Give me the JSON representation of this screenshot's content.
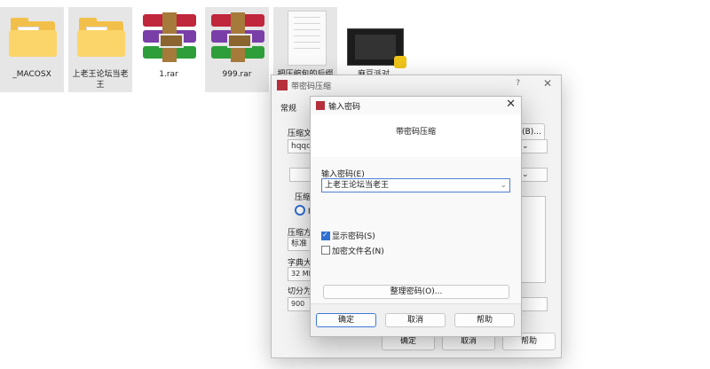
{
  "files": [
    {
      "name": "_MACOSX",
      "type": "folder",
      "selected": true
    },
    {
      "name": "上老王论坛当老王",
      "type": "folder",
      "selected": true
    },
    {
      "name": "1.rar",
      "type": "rar",
      "selected": false
    },
    {
      "name": "999.rar",
      "type": "rar",
      "selected": true
    },
    {
      "name": "把压缩包的后缀",
      "type": "document",
      "selected": true
    },
    {
      "name": "麻豆派对",
      "type": "video",
      "selected": false
    }
  ],
  "back_dialog": {
    "title": "带密码压缩",
    "help_icon": "?",
    "tab_general": "常规",
    "label_filename": "压缩文",
    "filename_value": "hqqq.r",
    "label_format": "压缩文",
    "format_option": "RA",
    "label_method": "压缩方",
    "method_value": "标准",
    "label_dict": "字典大",
    "dict_value": "32 MB",
    "label_split": "切分为",
    "split_value": "900",
    "browse_label": "(B)...",
    "ok_label": "确定",
    "cancel_label": "取消",
    "help_label": "帮助"
  },
  "password_dialog": {
    "title": "输入密码",
    "header": "带密码压缩",
    "password_label": "输入密码(E)",
    "password_value": "上老王论坛当老王",
    "show_password_label": "显示密码(S)",
    "show_password_checked": true,
    "encrypt_filenames_label": "加密文件名(N)",
    "encrypt_filenames_checked": false,
    "manage_button": "整理密码(O)...",
    "ok_label": "确定",
    "cancel_label": "取消",
    "help_label": "帮助"
  }
}
